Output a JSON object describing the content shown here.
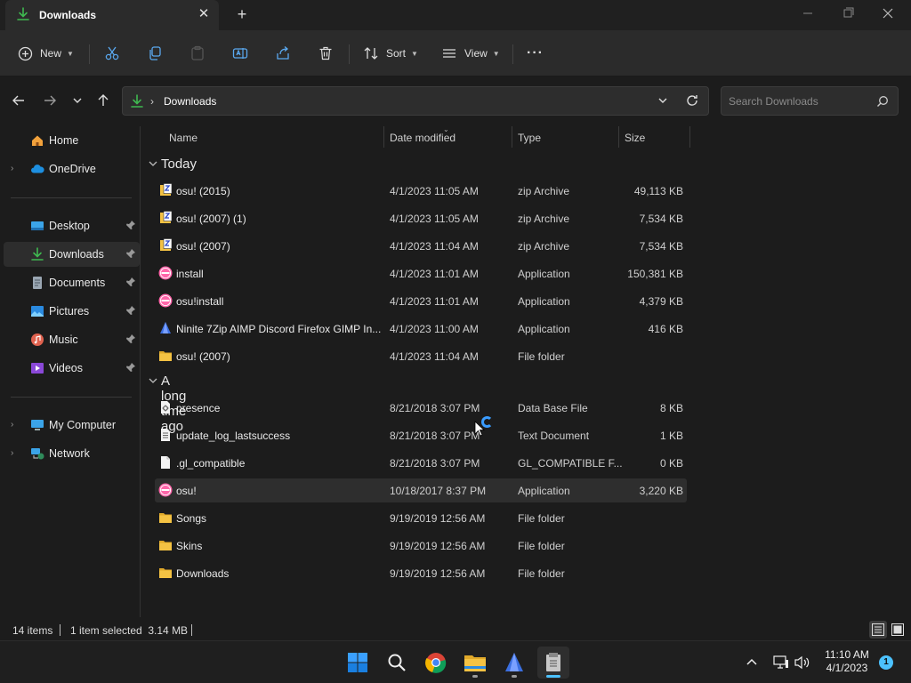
{
  "window": {
    "tab_title": "Downloads",
    "new_tab_label": "+"
  },
  "toolbar": {
    "new_label": "New",
    "sort_label": "Sort",
    "view_label": "View",
    "more_label": "···"
  },
  "address": {
    "path": "Downloads",
    "search_placeholder": "Search Downloads"
  },
  "sidebar": {
    "items": [
      {
        "label": "Home"
      },
      {
        "label": "OneDrive"
      },
      {
        "label": "Desktop"
      },
      {
        "label": "Downloads"
      },
      {
        "label": "Documents"
      },
      {
        "label": "Pictures"
      },
      {
        "label": "Music"
      },
      {
        "label": "Videos"
      },
      {
        "label": "My Computer"
      },
      {
        "label": "Network"
      }
    ]
  },
  "columns": {
    "name": "Name",
    "date": "Date modified",
    "type": "Type",
    "size": "Size"
  },
  "groups": [
    {
      "title": "Today",
      "rows": [
        {
          "name": "osu! (2015)",
          "date": "4/1/2023 11:05 AM",
          "type": "zip Archive",
          "size": "49,113 KB",
          "icon": "zip-icon"
        },
        {
          "name": "osu! (2007) (1)",
          "date": "4/1/2023 11:05 AM",
          "type": "zip Archive",
          "size": "7,534 KB",
          "icon": "zip-icon"
        },
        {
          "name": "osu! (2007)",
          "date": "4/1/2023 11:04 AM",
          "type": "zip Archive",
          "size": "7,534 KB",
          "icon": "zip-icon"
        },
        {
          "name": "install",
          "date": "4/1/2023 11:01 AM",
          "type": "Application",
          "size": "150,381 KB",
          "icon": "osu-app-icon"
        },
        {
          "name": "osu!install",
          "date": "4/1/2023 11:01 AM",
          "type": "Application",
          "size": "4,379 KB",
          "icon": "osu-app-icon"
        },
        {
          "name": "Ninite 7Zip AIMP Discord Firefox GIMP In...",
          "date": "4/1/2023 11:00 AM",
          "type": "Application",
          "size": "416 KB",
          "icon": "ninite-icon"
        },
        {
          "name": "osu! (2007)",
          "date": "4/1/2023 11:04 AM",
          "type": "File folder",
          "size": "",
          "icon": "folder-icon"
        }
      ]
    },
    {
      "title": "A long time ago",
      "rows": [
        {
          "name": "presence",
          "date": "8/21/2018 3:07 PM",
          "type": "Data Base File",
          "size": "8 KB",
          "icon": "file-gear-icon"
        },
        {
          "name": "update_log_lastsuccess",
          "date": "8/21/2018 3:07 PM",
          "type": "Text Document",
          "size": "1 KB",
          "icon": "text-file-icon"
        },
        {
          "name": ".gl_compatible",
          "date": "8/21/2018 3:07 PM",
          "type": "GL_COMPATIBLE F...",
          "size": "0 KB",
          "icon": "blank-file-icon"
        },
        {
          "name": "osu!",
          "date": "10/18/2017 8:37 PM",
          "type": "Application",
          "size": "3,220 KB",
          "icon": "osu-app-icon"
        },
        {
          "name": "Songs",
          "date": "9/19/2019 12:56 AM",
          "type": "File folder",
          "size": "",
          "icon": "folder-icon"
        },
        {
          "name": "Skins",
          "date": "9/19/2019 12:56 AM",
          "type": "File folder",
          "size": "",
          "icon": "folder-icon"
        },
        {
          "name": "Downloads",
          "date": "9/19/2019 12:56 AM",
          "type": "File folder",
          "size": "",
          "icon": "folder-icon"
        }
      ]
    }
  ],
  "status": {
    "count": "14 items",
    "selection": "1 item selected  3.14 MB"
  },
  "taskbar": {
    "time": "11:10 AM",
    "date": "4/1/2023",
    "notifications": "1"
  },
  "colors": {
    "accent": "#4cc2ff",
    "folder": "#f4c243",
    "download_green": "#3fb950",
    "osu_pink": "#ff66aa"
  }
}
